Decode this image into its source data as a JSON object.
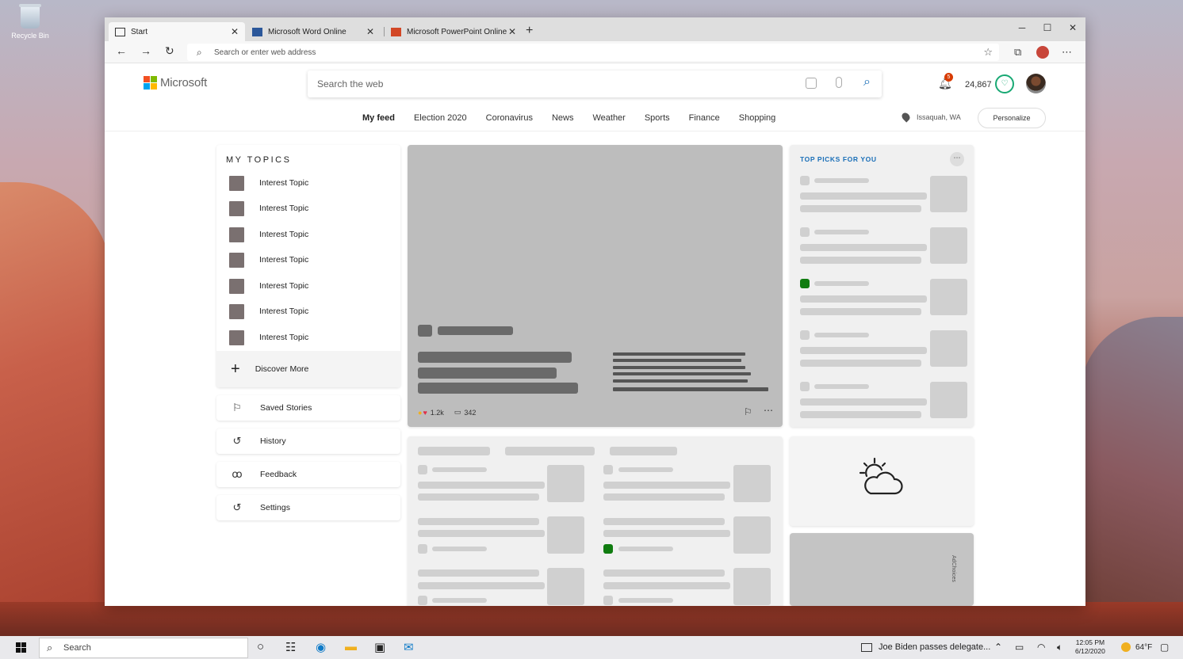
{
  "desktop": {
    "recycle_bin_label": "Recycle Bin"
  },
  "browser": {
    "tabs": [
      {
        "label": "Start",
        "icon": "newtab-icon"
      },
      {
        "label": "Microsoft Word Online",
        "icon": "word-icon"
      },
      {
        "label": "Microsoft PowerPoint Online",
        "icon": "powerpoint-icon"
      }
    ],
    "address_placeholder": "Search or enter web address"
  },
  "msn": {
    "brand": "Microsoft",
    "search_placeholder": "Search the web",
    "notification_count": "5",
    "points": "24,867",
    "nav": [
      "My feed",
      "Election 2020",
      "Coronavirus",
      "News",
      "Weather",
      "Sports",
      "Finance",
      "Shopping"
    ],
    "location": "Issaquah, WA",
    "personalize_label": "Personalize",
    "my_topics_title": "MY TOPICS",
    "topics": [
      "Interest Topic",
      "Interest Topic",
      "Interest Topic",
      "Interest Topic",
      "Interest Topic",
      "Interest Topic",
      "Interest Topic"
    ],
    "discover_label": "Discover More",
    "side_links": [
      "Saved Stories",
      "History",
      "Feedback",
      "Settings"
    ],
    "hero": {
      "likes": "1.2k",
      "comments": "342"
    },
    "top_picks_title": "TOP PICKS FOR YOU",
    "ad_label": "AdChoices"
  },
  "taskbar": {
    "search_placeholder": "Search",
    "news_ticker": "Joe Biden passes delegate...",
    "time": "12:05 PM",
    "date": "6/12/2020",
    "temperature": "64°F"
  },
  "colors": {
    "accent": "#1a6fb8",
    "rewards": "#19a974",
    "badge": "#d83b01",
    "pick_highlight": "#107c10"
  }
}
